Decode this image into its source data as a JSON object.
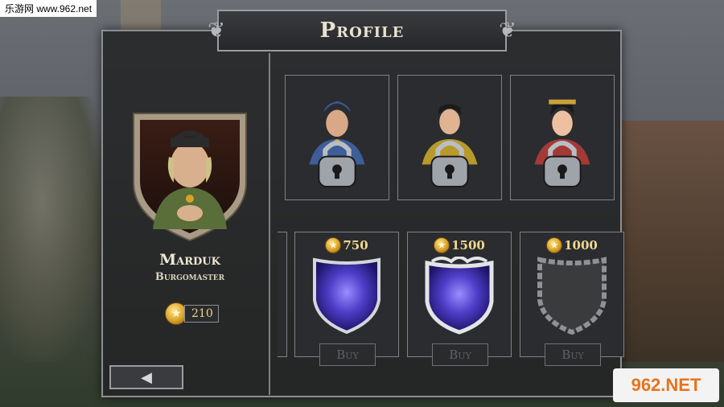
{
  "watermark_top": "乐游网 www.962.net",
  "watermark_bottom": "962.NET",
  "header": {
    "title": "Profile"
  },
  "profile": {
    "name": "Marduk",
    "rank": "Burgomaster",
    "coins": "210"
  },
  "characters": [
    {
      "id": "char-1",
      "locked": true,
      "icon": "lock-icon"
    },
    {
      "id": "char-2",
      "locked": true,
      "icon": "lock-icon"
    },
    {
      "id": "char-3",
      "locked": true,
      "icon": "lock-icon"
    }
  ],
  "shields": [
    {
      "price": "750",
      "buy_label": "Buy",
      "style": "blue-silver"
    },
    {
      "price": "1500",
      "buy_label": "Buy",
      "style": "blue-ornate"
    },
    {
      "price": "1000",
      "buy_label": "Buy",
      "style": "stone"
    }
  ],
  "back_button": {
    "icon": "arrow-left-icon"
  },
  "colors": {
    "gold": "#f0d88e",
    "panel": "#232426",
    "border": "#8d8f93"
  }
}
